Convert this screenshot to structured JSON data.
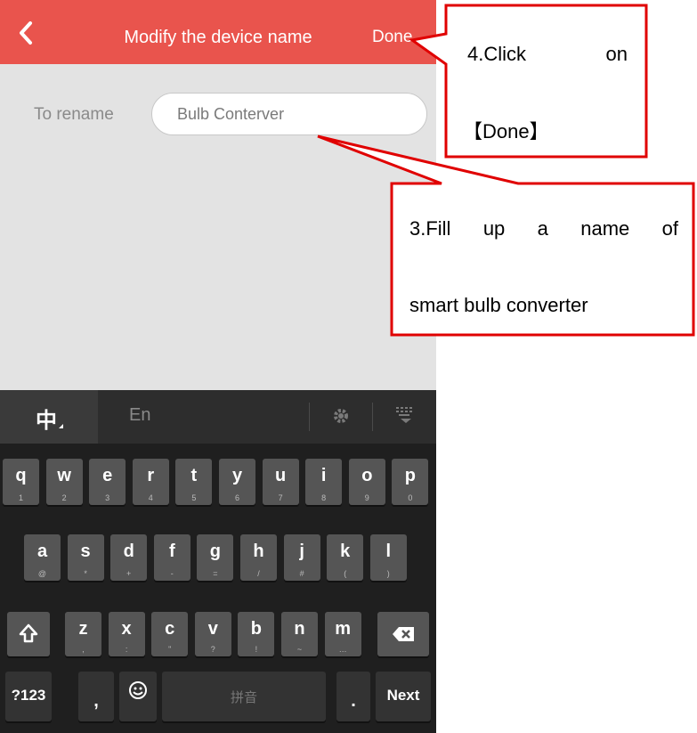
{
  "header": {
    "title": "Modify the device name",
    "done_label": "Done"
  },
  "form": {
    "label": "To rename",
    "value": "Bulb Conterver"
  },
  "keyboard": {
    "lang_cn": "中",
    "lang_en": "En",
    "row1": [
      {
        "k": "q",
        "s": "1"
      },
      {
        "k": "w",
        "s": "2"
      },
      {
        "k": "e",
        "s": "3"
      },
      {
        "k": "r",
        "s": "4"
      },
      {
        "k": "t",
        "s": "5"
      },
      {
        "k": "y",
        "s": "6"
      },
      {
        "k": "u",
        "s": "7"
      },
      {
        "k": "i",
        "s": "8"
      },
      {
        "k": "o",
        "s": "9"
      },
      {
        "k": "p",
        "s": "0"
      }
    ],
    "row2": [
      {
        "k": "a",
        "s": "@"
      },
      {
        "k": "s",
        "s": "*"
      },
      {
        "k": "d",
        "s": "+"
      },
      {
        "k": "f",
        "s": "-"
      },
      {
        "k": "g",
        "s": "="
      },
      {
        "k": "h",
        "s": "/"
      },
      {
        "k": "j",
        "s": "#"
      },
      {
        "k": "k",
        "s": "("
      },
      {
        "k": "l",
        "s": ")"
      }
    ],
    "row3": [
      {
        "k": "z",
        "s": ","
      },
      {
        "k": "x",
        "s": ":"
      },
      {
        "k": "c",
        "s": "\""
      },
      {
        "k": "v",
        "s": "?"
      },
      {
        "k": "b",
        "s": "!"
      },
      {
        "k": "n",
        "s": "~"
      },
      {
        "k": "m",
        "s": "…"
      }
    ],
    "num_label": "?123",
    "comma": ",",
    "space_label": "拼音",
    "period": ".",
    "next_label": "Next"
  },
  "annotations": {
    "step4_line1": "4.Click on",
    "step4_line2": "【Done】",
    "step3_line1": "3.Fill up a name of",
    "step3_line2": "smart bulb converter"
  },
  "colors": {
    "header": "#e9544d",
    "callout_border": "#e00000"
  }
}
